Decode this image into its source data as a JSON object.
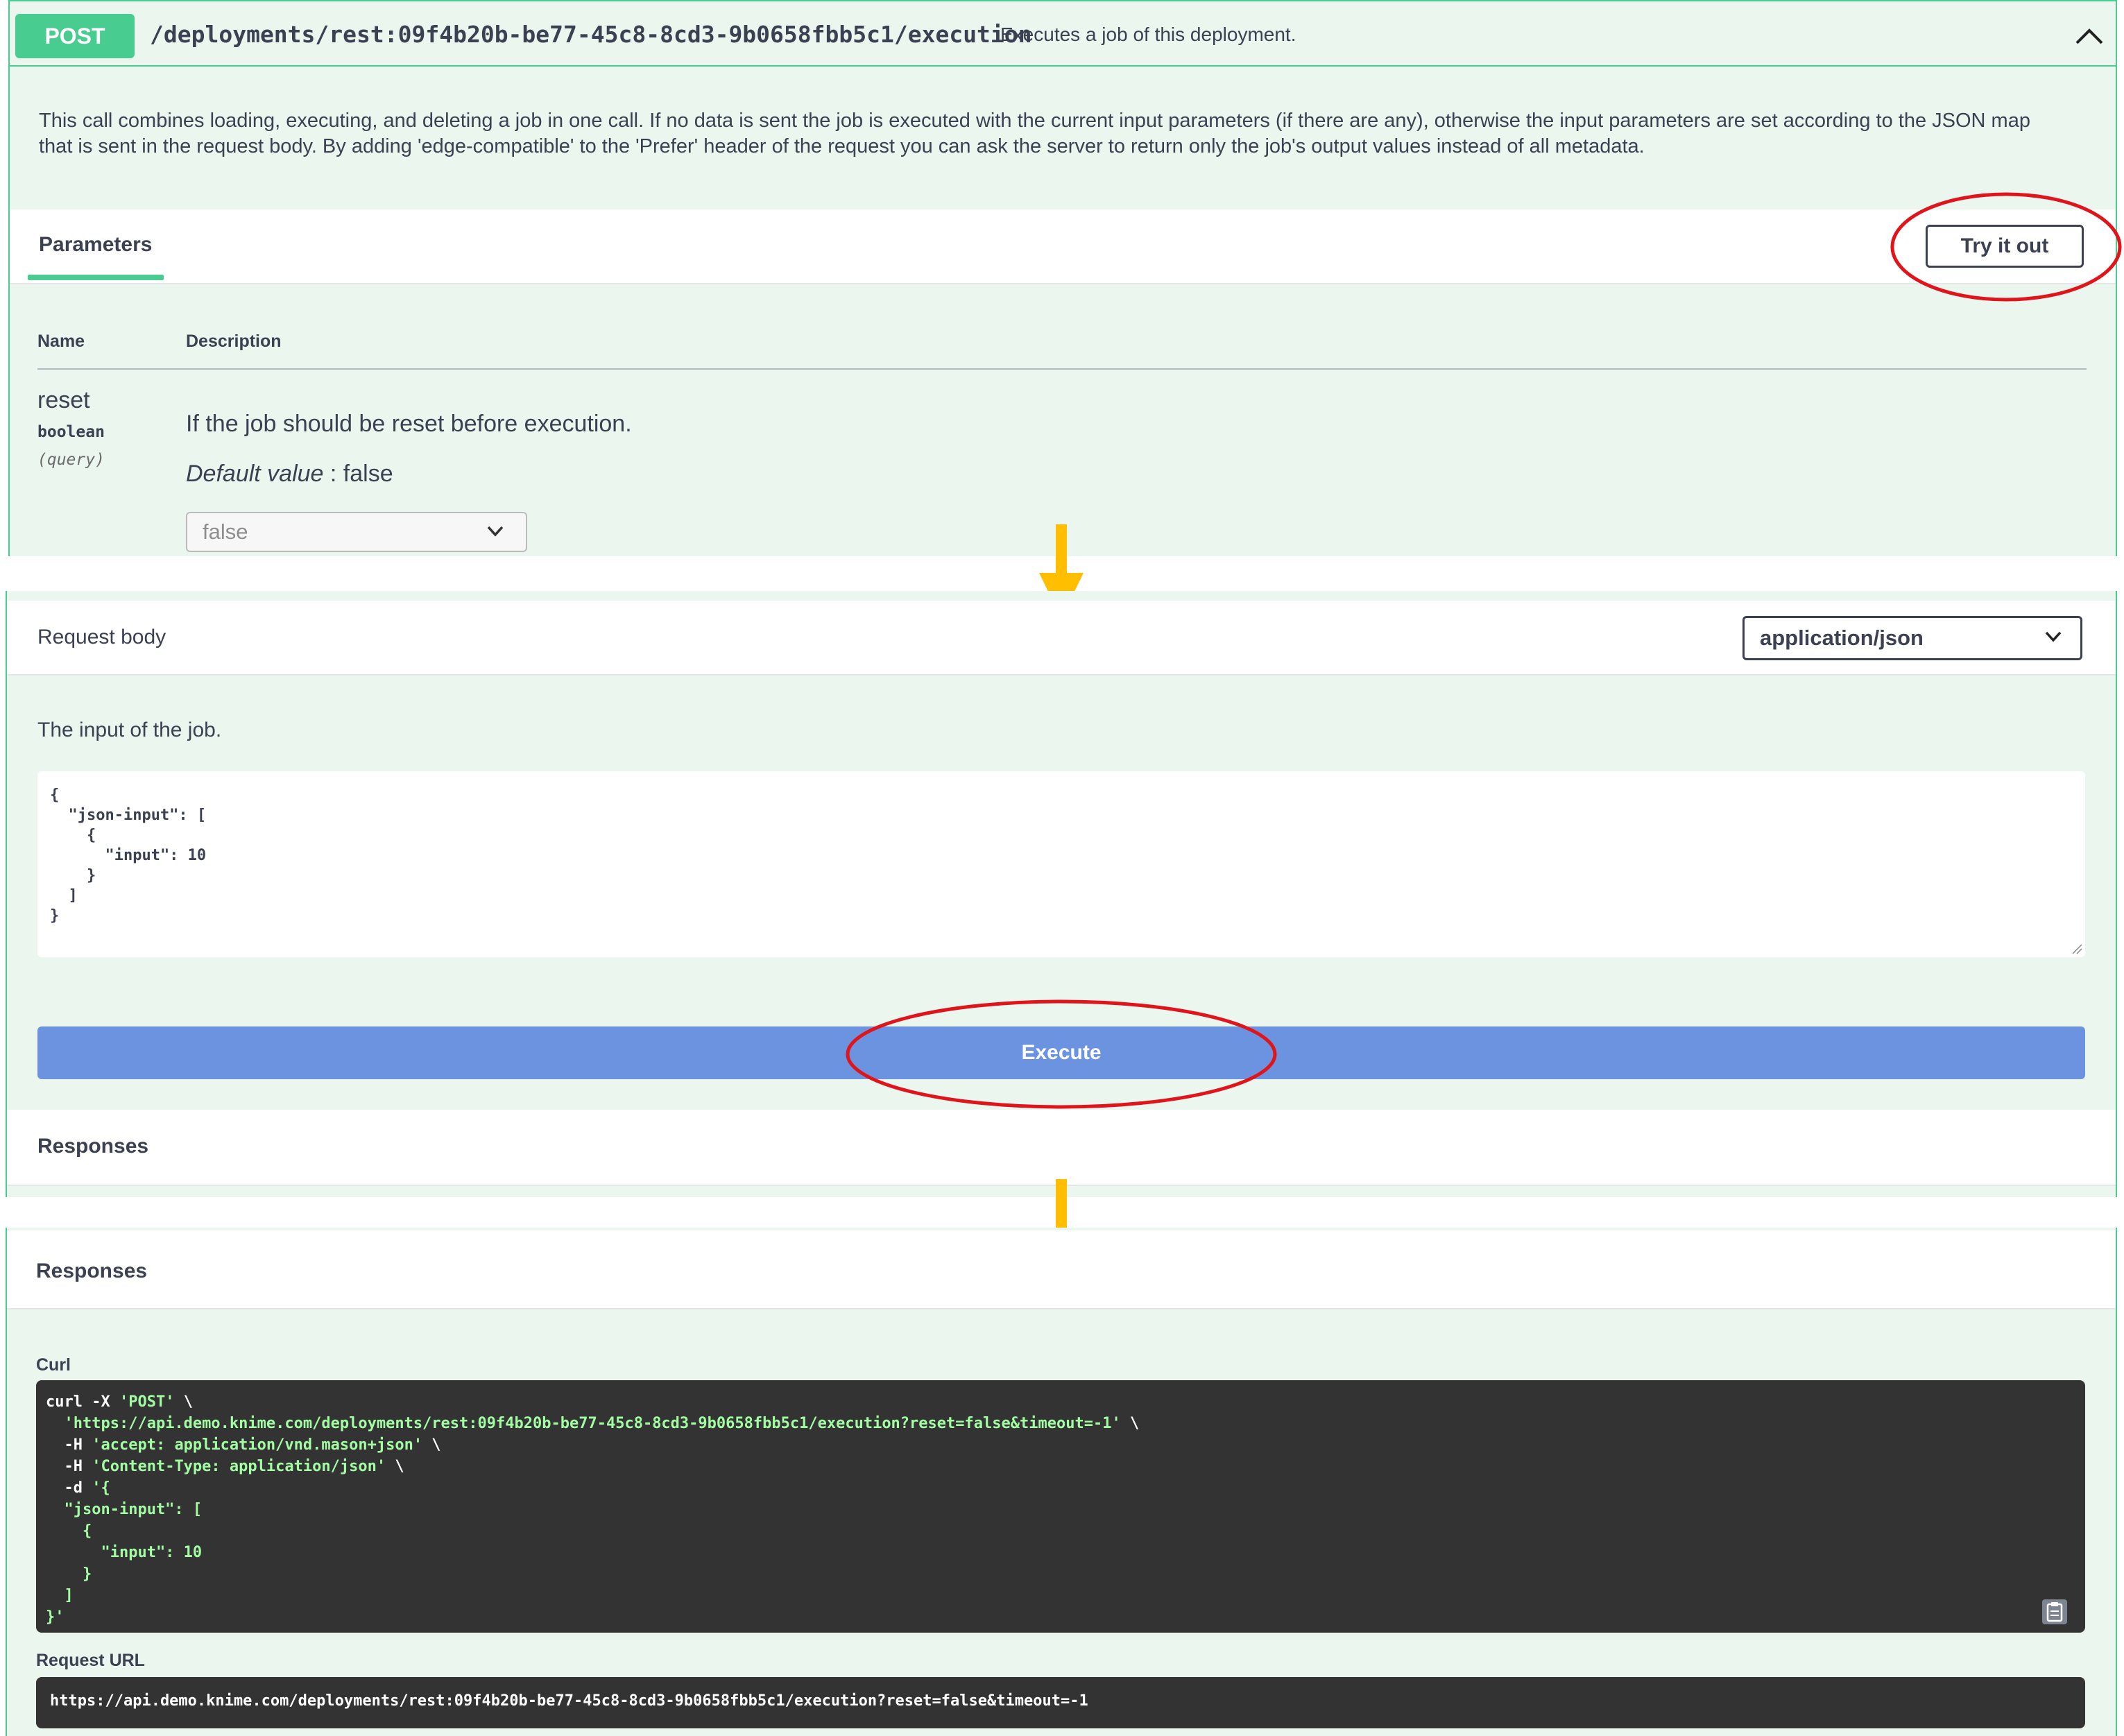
{
  "operation": {
    "method": "POST",
    "path": "/deployments/rest:09f4b20b-be77-45c8-8cd3-9b0658fbb5c1/execution",
    "summary": "Executes a job of this deployment.",
    "description": "This call combines loading, executing, and deleting a job in one call. If no data is sent the job is executed with the current input parameters (if there are any), otherwise the input parameters are set according to the JSON map that is sent in the request body. By adding 'edge-compatible' to the 'Prefer' header of the request you can ask the server to return only the job's output values instead of all metadata."
  },
  "parameters": {
    "tab_label": "Parameters",
    "try_it_out_label": "Try it out",
    "columns": {
      "name": "Name",
      "description": "Description"
    },
    "param": {
      "name": "reset",
      "type": "boolean",
      "location": "(query)",
      "description": "If the job should be reset before execution.",
      "default_label": "Default value",
      "default_sep": " : false",
      "selected_value": "false"
    }
  },
  "request_body": {
    "label": "Request body",
    "content_type": "application/json",
    "description": "The input of the job.",
    "body": "{\n  \"json-input\": [\n    {\n      \"input\": 10\n    }\n  ]\n}"
  },
  "execute_label": "Execute",
  "responses_label": "Responses",
  "responses": {
    "curl_label": "Curl",
    "curl_lines": [
      {
        "pre": "curl -X ",
        "str": "'POST'",
        "post": " \\"
      },
      {
        "pre": "  ",
        "str": "'https://api.demo.knime.com/deployments/rest:09f4b20b-be77-45c8-8cd3-9b0658fbb5c1/execution?reset=false&timeout=-1'",
        "post": " \\"
      },
      {
        "pre": "  -H ",
        "str": "'accept: application/vnd.mason+json'",
        "post": " \\"
      },
      {
        "pre": "  -H ",
        "str": "'Content-Type: application/json'",
        "post": " \\"
      },
      {
        "pre": "  -d ",
        "str": "'{",
        "post": ""
      },
      {
        "pre": "",
        "str": "  \"json-input\": [",
        "post": ""
      },
      {
        "pre": "",
        "str": "    {",
        "post": ""
      },
      {
        "pre": "",
        "str": "      \"input\": 10",
        "post": ""
      },
      {
        "pre": "",
        "str": "    }",
        "post": ""
      },
      {
        "pre": "",
        "str": "  ]",
        "post": ""
      },
      {
        "pre": "",
        "str": "}'",
        "post": ""
      }
    ],
    "request_url_label": "Request URL",
    "request_url": "https://api.demo.knime.com/deployments/rest:09f4b20b-be77-45c8-8cd3-9b0658fbb5c1/execution?reset=false&timeout=-1"
  },
  "colors": {
    "post_green": "#49cc90",
    "panel_bg": "#ebf6ef",
    "execute_blue": "#6b93e0",
    "annotation_red": "#e0151b",
    "arrow_yellow": "#ffbf00"
  },
  "icons": {
    "collapse": "chevron-up-icon",
    "select": "chevron-down-icon",
    "copy": "clipboard-copy-icon"
  }
}
